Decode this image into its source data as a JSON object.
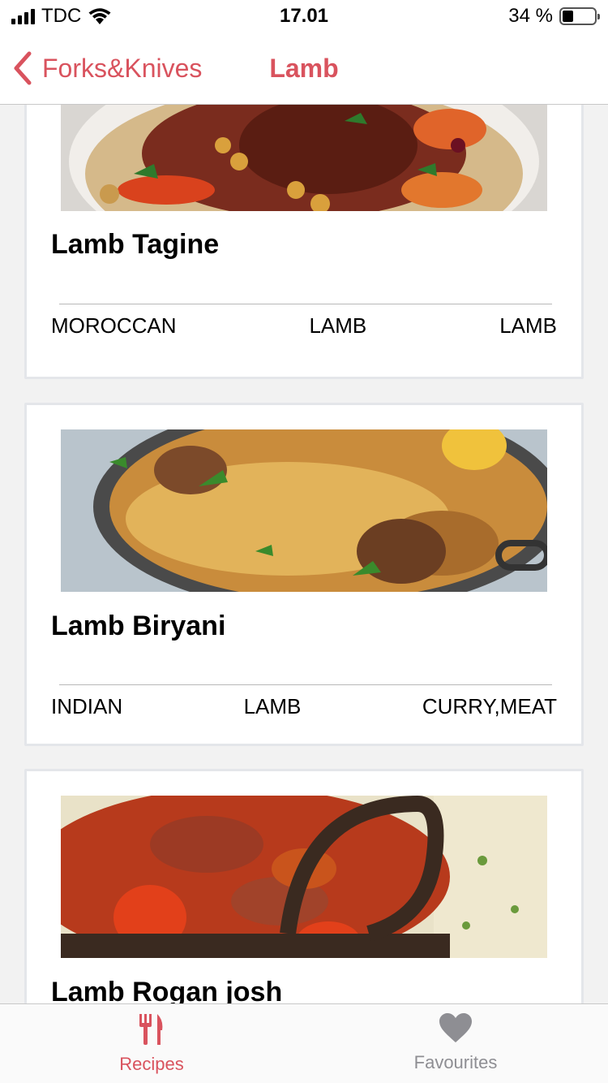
{
  "status_bar": {
    "carrier": "TDC",
    "time": "17.01",
    "battery_percent": "34 %",
    "battery_level": 0.34
  },
  "nav": {
    "back_label": "Forks&Knives",
    "title": "Lamb"
  },
  "recipes": [
    {
      "title": "Lamb Tagine",
      "tags": [
        "MOROCCAN",
        "LAMB",
        "LAMB"
      ]
    },
    {
      "title": "Lamb Biryani",
      "tags": [
        "INDIAN",
        "LAMB",
        "CURRY,MEAT"
      ]
    },
    {
      "title": "Lamb Rogan josh",
      "tags": []
    }
  ],
  "tab_bar": {
    "tabs": [
      {
        "label": "Recipes",
        "icon": "fork-knife-icon",
        "active": true
      },
      {
        "label": "Favourites",
        "icon": "heart-icon",
        "active": false
      }
    ]
  },
  "colors": {
    "accent": "#d9535e",
    "inactive": "#8e8e93",
    "background": "#f2f2f2"
  }
}
